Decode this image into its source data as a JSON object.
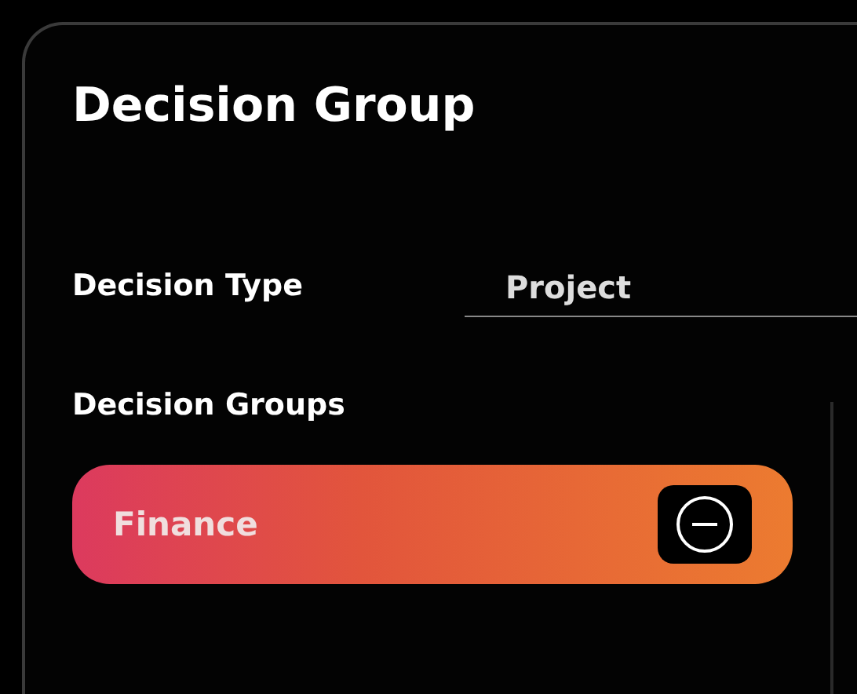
{
  "title": "Decision Group",
  "decision_type": {
    "label": "Decision Type",
    "value": "Project"
  },
  "decision_groups": {
    "label": "Decision Groups",
    "items": [
      {
        "name": "Finance"
      }
    ]
  }
}
